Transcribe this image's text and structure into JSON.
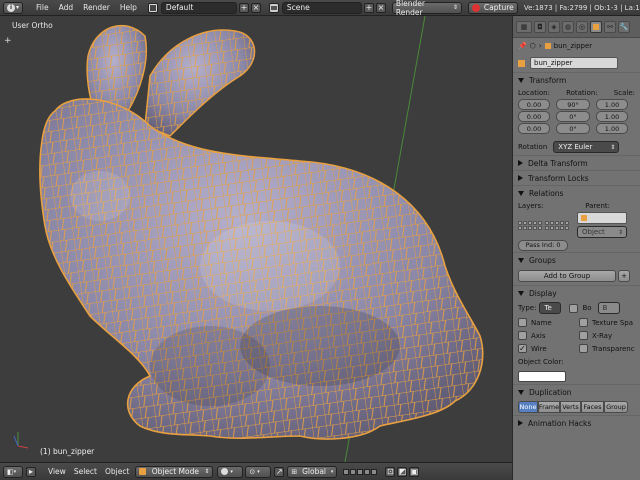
{
  "topbar": {
    "menus": [
      "File",
      "Add",
      "Render",
      "Help"
    ],
    "screen_layout": "Default",
    "scene": "Scene",
    "render_engine": "Blender Render",
    "capture_label": "Capture",
    "stats": "Ve:1873 | Fa:2799 | Ob:1-3 | La:1"
  },
  "viewport": {
    "label": "User Ortho",
    "object_label": "(1) bun_zipper"
  },
  "bottombar": {
    "menus": [
      "View",
      "Select",
      "Object"
    ],
    "mode": "Object Mode",
    "pivot": "Global"
  },
  "props": {
    "breadcrumb": "bun_zipper",
    "object_name": "bun_zipper",
    "transform": {
      "title": "Transform",
      "location_label": "Location:",
      "rotation_label": "Rotation:",
      "scale_label": "Scale:",
      "location": [
        "0.00",
        "0.00",
        "0.00"
      ],
      "rotation": [
        "90°",
        "0°",
        "0°"
      ],
      "scale": [
        "1.00",
        "1.00",
        "1.00"
      ],
      "rotation_mode_label": "Rotation",
      "rotation_mode": "XYZ Euler"
    },
    "delta_transform": "Delta Transform",
    "transform_locks": "Transform Locks",
    "relations": {
      "title": "Relations",
      "layers_label": "Layers:",
      "parent_label": "Parent:",
      "parent_type": "Object",
      "pass_index": "Pass Ind: 0"
    },
    "groups": {
      "title": "Groups",
      "add_button": "Add to Group"
    },
    "display": {
      "title": "Display",
      "type_label": "Type:",
      "type_value": "Te",
      "bo_label": "Bo",
      "bo_value": "B",
      "name": "Name",
      "axis": "Axis",
      "wire": "Wire",
      "texture_space": "Texture Spa",
      "xray": "X-Ray",
      "transparency": "Transparenc",
      "object_color_label": "Object Color:"
    },
    "duplication": {
      "title": "Duplication",
      "options": [
        "None",
        "Frame",
        "Verts",
        "Faces",
        "Group"
      ]
    },
    "animation_hacks": "Animation Hacks"
  },
  "colors": {
    "wire": "#e8a040",
    "mesh": "#8a86a6",
    "panel": "#727272",
    "viewport": "#3d3d3d",
    "accent": "#5680c2"
  }
}
